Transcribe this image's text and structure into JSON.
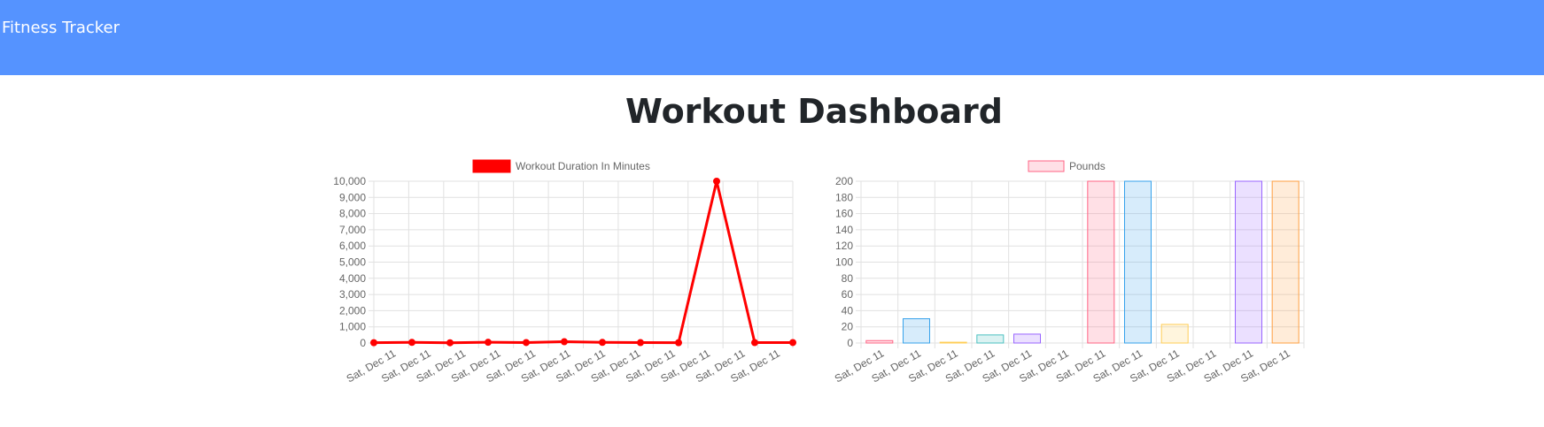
{
  "navbar": {
    "brand": "Fitness Tracker",
    "color": "#5593ff"
  },
  "page": {
    "title": "Workout Dashboard"
  },
  "chart_data": [
    {
      "type": "line",
      "legend": "top",
      "grid": true,
      "categories": [
        "Sat, Dec 11",
        "Sat, Dec 11",
        "Sat, Dec 11",
        "Sat, Dec 11",
        "Sat, Dec 11",
        "Sat, Dec 11",
        "Sat, Dec 11",
        "Sat, Dec 11",
        "Sat, Dec 11",
        "Sat, Dec 11",
        "Sat, Dec 11",
        "Sat, Dec 11"
      ],
      "ylim": [
        0,
        10000
      ],
      "yticks": [
        0,
        1000,
        2000,
        3000,
        4000,
        5000,
        6000,
        7000,
        8000,
        9000,
        10000
      ],
      "ytick_labels": [
        "0",
        "1,000",
        "2,000",
        "3,000",
        "4,000",
        "5,000",
        "6,000",
        "7,000",
        "8,000",
        "9,000",
        "10,000"
      ],
      "series": [
        {
          "name": "Workout Duration In Minutes",
          "color": "#ff0000",
          "values": [
            20,
            40,
            15,
            45,
            30,
            80,
            40,
            25,
            20,
            10000,
            25,
            30
          ]
        }
      ]
    },
    {
      "type": "bar",
      "legend": "top",
      "grid": true,
      "categories": [
        "Sat, Dec 11",
        "Sat, Dec 11",
        "Sat, Dec 11",
        "Sat, Dec 11",
        "Sat, Dec 11",
        "Sat, Dec 11",
        "Sat, Dec 11",
        "Sat, Dec 11",
        "Sat, Dec 11",
        "Sat, Dec 11",
        "Sat, Dec 11",
        "Sat, Dec 11"
      ],
      "ylim": [
        0,
        200
      ],
      "yticks": [
        0,
        20,
        40,
        60,
        80,
        100,
        120,
        140,
        160,
        180,
        200
      ],
      "ytick_labels": [
        "0",
        "20",
        "40",
        "60",
        "80",
        "100",
        "120",
        "140",
        "160",
        "180",
        "200"
      ],
      "series": [
        {
          "name": "Pounds",
          "legend_color": "#ff6384",
          "values": [
            3,
            30,
            1,
            10,
            11,
            0,
            200,
            200,
            23,
            0,
            200,
            200
          ],
          "bar_colors": [
            "#ff6384",
            "#36a2eb",
            "#ffce56",
            "#4bc0c0",
            "#9966ff",
            "#ff9f40",
            "#ff6384",
            "#36a2eb",
            "#ffce56",
            "#4bc0c0",
            "#9966ff",
            "#ff9f40"
          ]
        }
      ]
    }
  ]
}
